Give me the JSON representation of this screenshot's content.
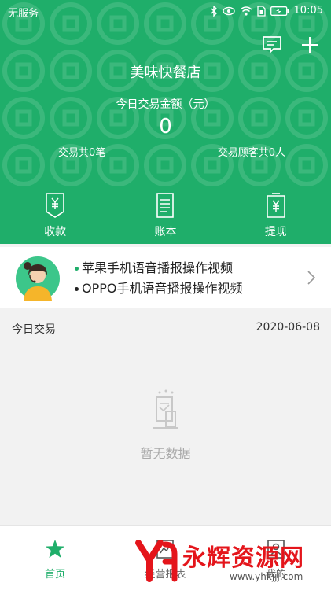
{
  "status_bar": {
    "carrier": "无服务",
    "time": "10:05"
  },
  "header": {
    "store_name": "美味快餐店",
    "amount_label": "今日交易金额（元）",
    "amount_value": "0",
    "transactions": "交易共0笔",
    "customers": "交易顾客共0人",
    "actions": [
      {
        "label": "收款",
        "icon": "receipt-yen-icon"
      },
      {
        "label": "账本",
        "icon": "ledger-icon"
      },
      {
        "label": "提现",
        "icon": "withdraw-yen-icon"
      }
    ]
  },
  "promo": {
    "links": [
      "苹果手机语音播报操作视频",
      "OPPO手机语音播报操作视频"
    ]
  },
  "today": {
    "title": "今日交易",
    "date": "2020-06-08"
  },
  "empty": {
    "text": "暂无数据"
  },
  "tabbar": {
    "items": [
      {
        "label": "首页",
        "icon": "star-icon",
        "active": true
      },
      {
        "label": "经营报表",
        "icon": "report-icon",
        "active": false
      },
      {
        "label": "我的",
        "icon": "profile-icon",
        "active": false
      }
    ]
  },
  "watermark": {
    "text": "永辉资源网",
    "url": "www.yhkjjj.com"
  },
  "colors": {
    "primary": "#1fae6a",
    "watermark_red": "#e4151b"
  }
}
